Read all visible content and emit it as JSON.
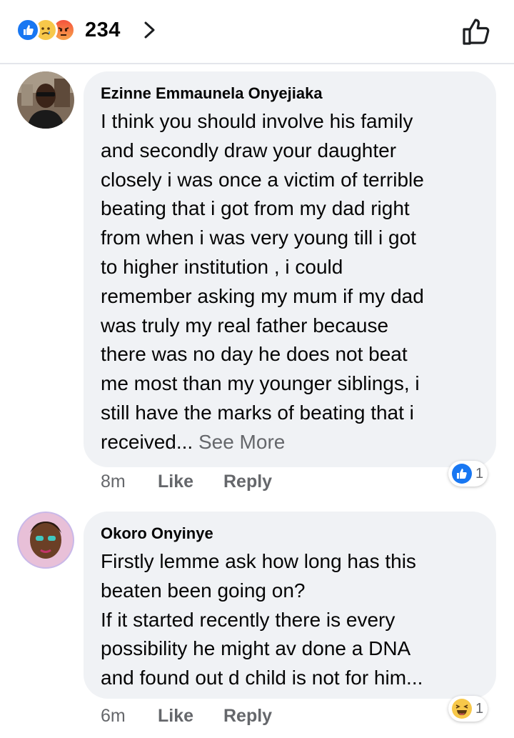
{
  "header": {
    "reaction_icons": [
      "like-reaction-icon",
      "sad-reaction-icon",
      "angry-reaction-icon"
    ],
    "reaction_count": "234"
  },
  "comments": [
    {
      "author": "Ezinne Emmaunela Onyejiaka",
      "lines": [
        "I think you should involve his family",
        "and secondly draw your daughter",
        "closely i was once a victim of terrible",
        "beating that i got from my dad right",
        "from when i was very young till i got",
        "to higher institution , i could",
        "remember asking my mum if my dad",
        "was truly my real father because",
        "there was no day he does not beat",
        "me most than my younger siblings, i",
        "still have the marks of beating that i",
        "received..."
      ],
      "see_more": "See More",
      "time": "8m",
      "like_label": "Like",
      "reply_label": "Reply",
      "reaction_icon": "like-reaction-icon",
      "reaction_count": "1"
    },
    {
      "author": "Okoro Onyinye",
      "lines": [
        "Firstly lemme ask how long has this",
        "beaten been going on?",
        "If it started recently there is every",
        "possibility he might av done a DNA",
        "and found out d child is not for him..."
      ],
      "time": "6m",
      "like_label": "Like",
      "reply_label": "Reply",
      "reaction_icon": "haha-reaction-icon",
      "reaction_count": "1"
    }
  ],
  "colors": {
    "like_blue": "#1877f2",
    "bubble_bg": "#f0f2f5",
    "secondary_text": "#65676b"
  }
}
